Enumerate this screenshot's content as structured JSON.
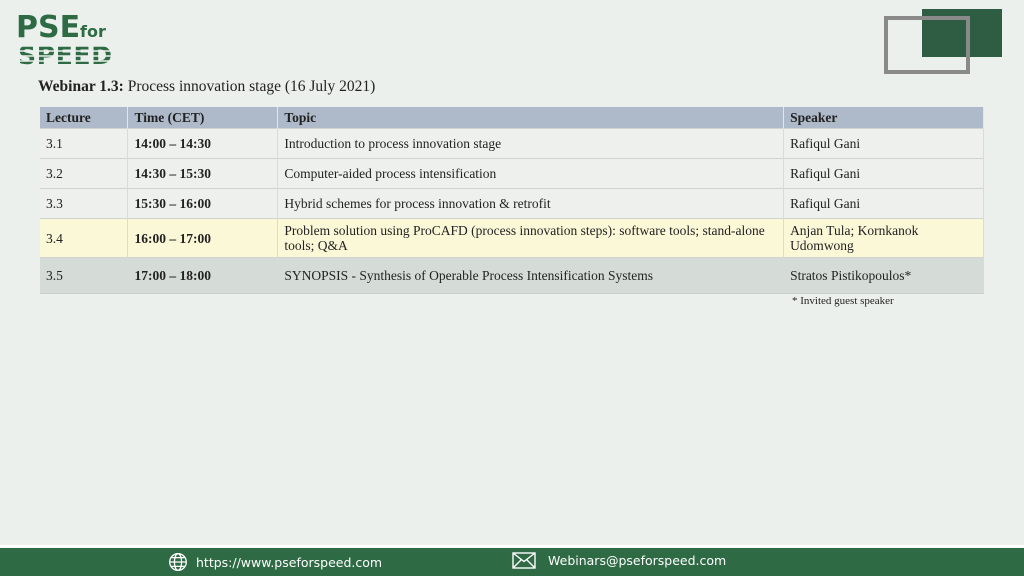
{
  "logo": {
    "line1": "PSE",
    "for": "for",
    "line2": "SPEED"
  },
  "heading": {
    "label": "Webinar 1.3:",
    "text": "Process innovation stage (16 July 2021)"
  },
  "table": {
    "columns": [
      "Lecture",
      "Time (CET)",
      "Topic",
      "Speaker"
    ],
    "rows": [
      {
        "lecture": "3.1",
        "time": "14:00 – 14:30",
        "topic": "Introduction to process innovation stage",
        "speaker": "Rafiqul Gani"
      },
      {
        "lecture": "3.2",
        "time": "14:30 – 15:30",
        "topic": "Computer-aided process intensification",
        "speaker": "Rafiqul Gani"
      },
      {
        "lecture": "3.3",
        "time": "15:30 – 16:00",
        "topic": "Hybrid schemes for process innovation & retrofit",
        "speaker": "Rafiqul Gani"
      },
      {
        "lecture": "3.4",
        "time": "16:00 – 17:00",
        "topic": "Problem solution using ProCAFD (process innovation steps): software tools; stand-alone tools; Q&A",
        "speaker": "Anjan Tula; Kornkanok Udomwong"
      },
      {
        "lecture": "3.5",
        "time": "17:00 – 18:00",
        "topic": "SYNOPSIS - Synthesis of Operable Process Intensification Systems",
        "speaker": "Stratos Pistikopoulos*"
      }
    ]
  },
  "note": "* Invited guest speaker",
  "footer": {
    "website": "https://www.pseforspeed.com",
    "email": "Webinars@pseforspeed.com"
  },
  "colors": {
    "brand_green": "#2e6b45",
    "header_row": "#aeb9c9",
    "highlight_row": "#fbf8d8"
  }
}
